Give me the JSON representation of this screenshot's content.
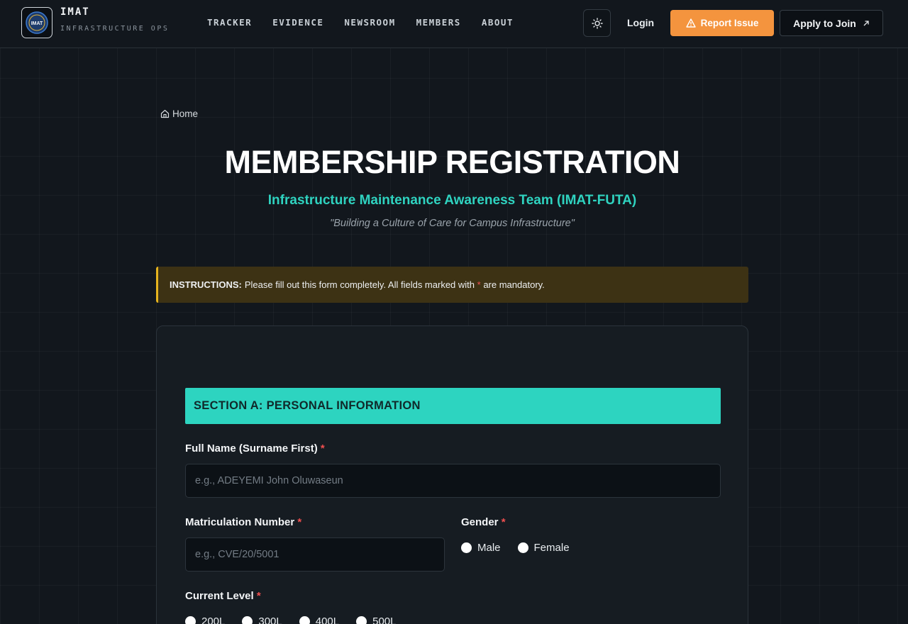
{
  "header": {
    "brand_name": "IMAT",
    "brand_sub": "INFRASTRUCTURE OPS",
    "logo_text": "IMAT",
    "nav": [
      "TRACKER",
      "EVIDENCE",
      "NEWSROOM",
      "MEMBERS",
      "ABOUT"
    ],
    "login_label": "Login",
    "report_label": "Report Issue",
    "apply_label": "Apply to Join"
  },
  "hero": {
    "breadcrumb": "Home",
    "title": "MEMBERSHIP REGISTRATION",
    "subtitle": "Infrastructure Maintenance Awareness Team (IMAT-FUTA)",
    "tagline": "\"Building a Culture of Care for Campus Infrastructure\""
  },
  "instructions": {
    "prefix": "INSTRUCTIONS:",
    "text_before": "Please fill out this form completely. All fields marked with",
    "marker": "*",
    "text_after": "are mandatory."
  },
  "form": {
    "section_a": "SECTION A: PERSONAL INFORMATION",
    "full_name_label": "Full Name (Surname First)",
    "full_name_placeholder": "e.g., ADEYEMI John Oluwaseun",
    "full_name_value": "",
    "matric_label": "Matriculation Number",
    "matric_placeholder": "e.g., CVE/20/5001",
    "matric_value": "",
    "gender_label": "Gender",
    "gender_options": [
      "Male",
      "Female"
    ],
    "level_label": "Current Level",
    "level_options": [
      "200L",
      "300L",
      "400L",
      "500L"
    ],
    "required_marker": "*"
  },
  "colors": {
    "accent_teal": "#2dd4c0",
    "accent_orange": "#f4943e",
    "warning_bg": "#3d3214",
    "warning_border": "#e6b41e",
    "required_red": "#f04f4f"
  }
}
